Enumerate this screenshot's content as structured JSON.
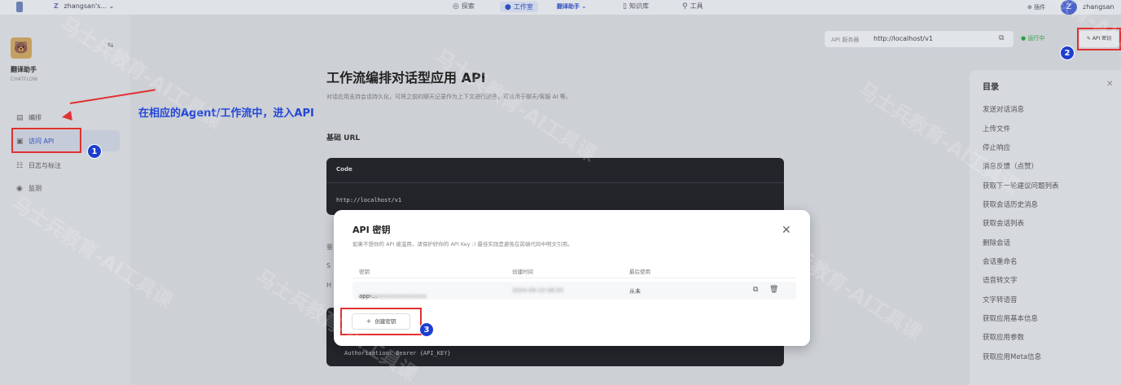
{
  "topbar": {
    "workspace_initial": "Z",
    "workspace_name": "zhangsan's...",
    "nav": [
      {
        "icon": "compass-icon",
        "label": "探索"
      },
      {
        "icon": "workspace-icon",
        "label": "工作室"
      },
      {
        "icon": "book-icon",
        "label": "知识库"
      },
      {
        "icon": "tools-icon",
        "label": "工具"
      }
    ],
    "app_chip": "翻译助手",
    "plugins_label": "插件",
    "user_initial": "Z",
    "user_name": "zhangsan"
  },
  "sidebar": {
    "app_name": "翻译助手",
    "app_type": "CHATFLOW",
    "items": [
      {
        "icon": "overview-icon",
        "label": "编排"
      },
      {
        "icon": "api-icon",
        "label": "访问 API"
      },
      {
        "icon": "logs-icon",
        "label": "日志与标注"
      },
      {
        "icon": "monitor-icon",
        "label": "监测"
      }
    ]
  },
  "annotation": {
    "text": "在相应的Agent/工作流中，进入API",
    "badges": [
      "1",
      "2",
      "3"
    ]
  },
  "header": {
    "url_label": "API 服务器",
    "url_value": "http://localhost/v1",
    "status": "运行中",
    "api_button": "API 密钥"
  },
  "doc": {
    "title": "工作流编排对话型应用 API",
    "description": "对话应用支持会话持久化，可将之前的聊天记录作为上下文进行回答，可适用于聊天/客服 AI 等。",
    "base_url_heading": "基础 URL",
    "code_header": "Code",
    "code_body": "http://localhost/v1",
    "auth_line": "Authorization: Bearer {API_KEY}",
    "peek_1": "鉴",
    "peek_2": "S",
    "peek_3": "H"
  },
  "toc": {
    "title": "目录",
    "items": [
      "发送对话消息",
      "上传文件",
      "停止响应",
      "消息反馈（点赞）",
      "获取下一轮建议问题列表",
      "获取会话历史消息",
      "获取会话列表",
      "删除会话",
      "会话重命名",
      "语音转文字",
      "文字转语音",
      "获取应用基本信息",
      "获取应用参数",
      "获取应用Meta信息"
    ]
  },
  "modal": {
    "title": "API 密钥",
    "description": "如果不想你的 API 被滥用，请保护好你的 API Key :) 最佳实践是避免在前端代码中明文引用。",
    "columns": [
      "密钥",
      "创建时间",
      "最后使用"
    ],
    "row": {
      "key": "app-...",
      "created": "2024-09-10 08:55",
      "last_used": "从未"
    },
    "create_button": "创建密钥"
  },
  "watermark": "马士兵教育-AI工具课"
}
